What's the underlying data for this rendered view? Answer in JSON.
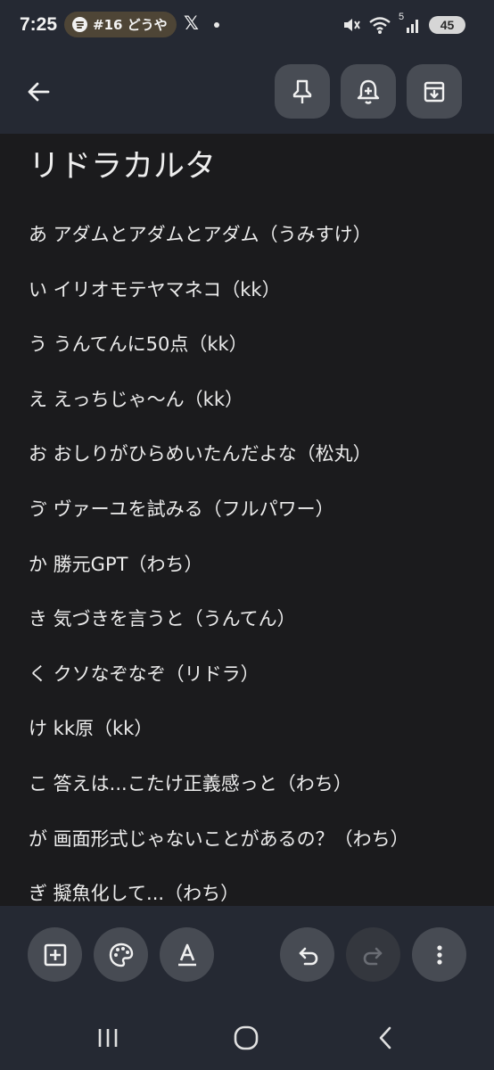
{
  "status_bar": {
    "time": "7:25",
    "media_text": "#16 どうや",
    "notification_x_icon": "x-logo-icon",
    "network_label": "5",
    "battery_level": "45"
  },
  "app_bar": {
    "back_icon": "arrow-left-icon",
    "pin_icon": "pin-icon",
    "reminder_icon": "bell-plus-icon",
    "archive_icon": "archive-icon"
  },
  "note": {
    "title": "リドラカルタ",
    "lines": [
      "あ アダムとアダムとアダム（うみすけ）",
      "い イリオモテヤマネコ（kk）",
      "う うんてんに50点（kk）",
      "え えっちじゃ〜ん（kk）",
      "お おしりがひらめいたんだよな（松丸）",
      "ゔ ヴァーユを試みる（フルパワー）",
      "か 勝元GPT（わち）",
      "き 気づきを言うと（うんてん）",
      "く クソなぞなぞ（リドラ）",
      "け kk原（kk）",
      "こ 答えは...こたけ正義感っと（わち）",
      "が 画面形式じゃないことがあるの？（わち）",
      "ぎ 擬魚化して...（わち）"
    ]
  },
  "bottom_toolbar": {
    "add_icon": "add-box-icon",
    "palette_icon": "palette-icon",
    "text_format_icon": "text-format-icon",
    "undo_icon": "undo-icon",
    "redo_icon": "redo-icon",
    "more_icon": "more-vertical-icon"
  },
  "nav_bar": {
    "recents_icon": "recents-icon",
    "home_icon": "home-icon",
    "back_icon": "back-chevron-icon"
  },
  "colors": {
    "background": "#1b1b1d",
    "bar_background": "#252933",
    "button_background": "#484c54",
    "text": "#ececec"
  }
}
